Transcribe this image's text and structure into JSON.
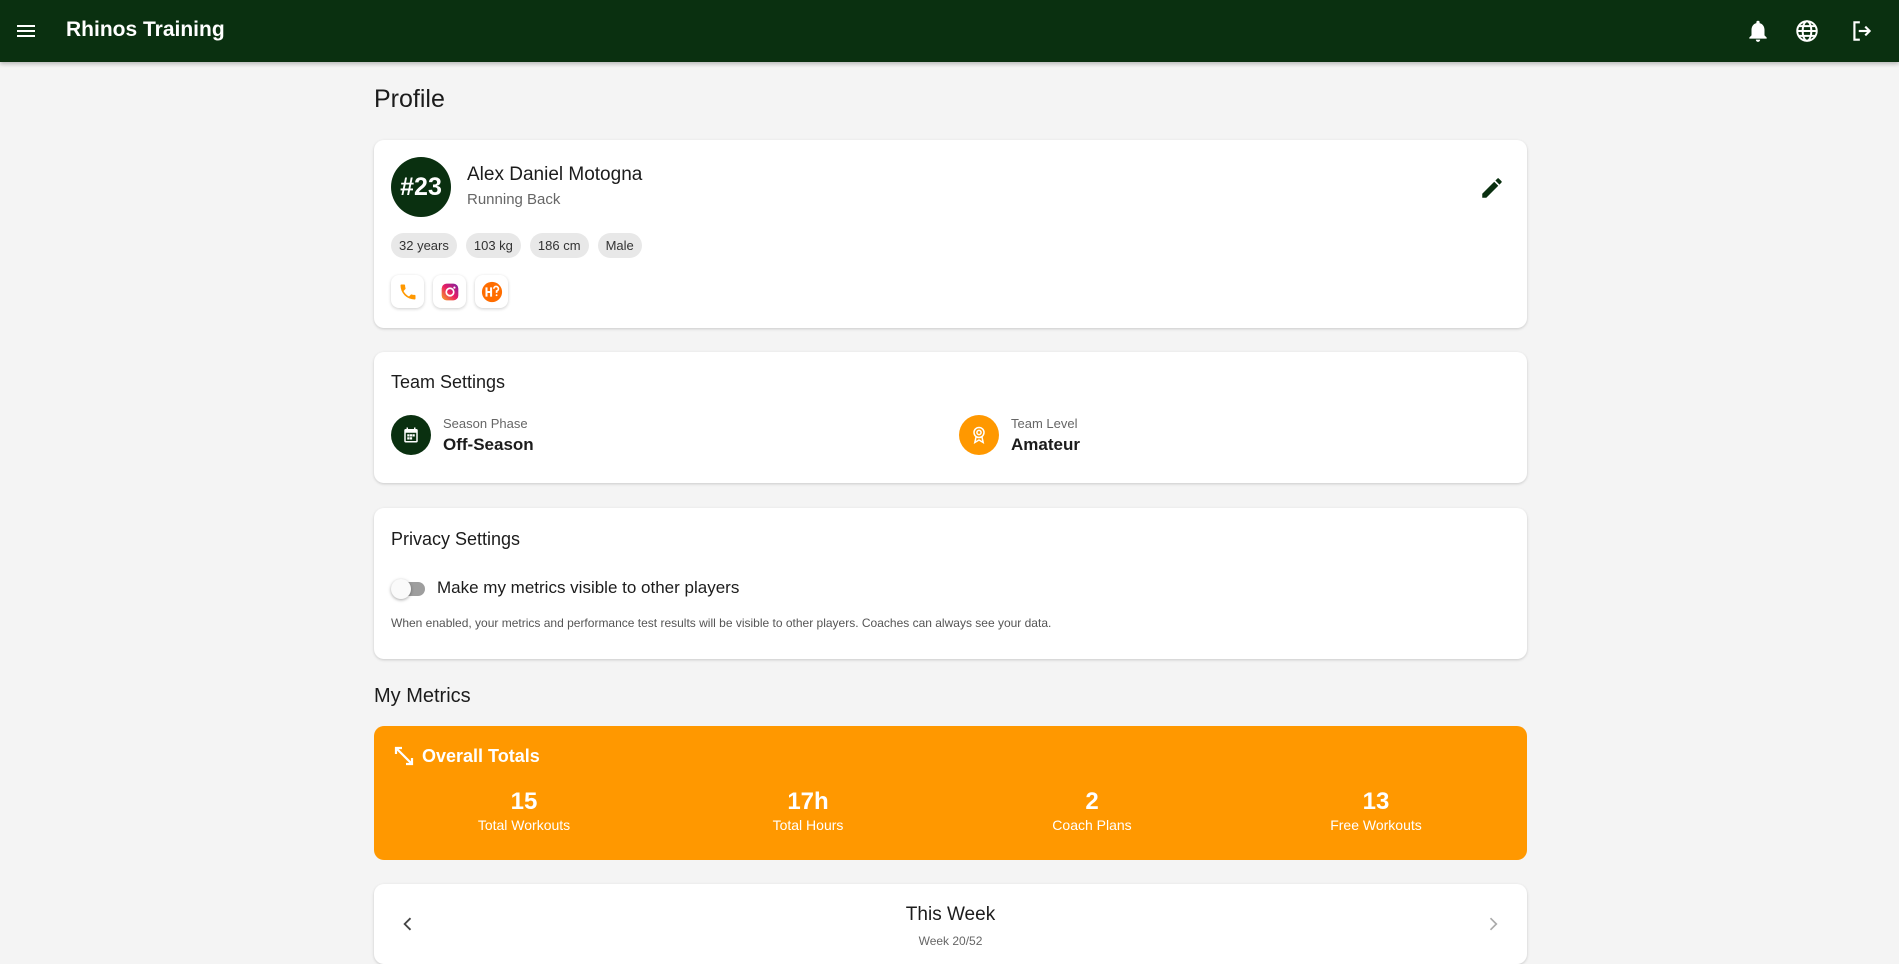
{
  "header": {
    "app_title": "Rhinos Training",
    "icons": [
      "menu-icon",
      "bell-icon",
      "globe-icon",
      "logout-icon"
    ]
  },
  "page": {
    "title": "Profile"
  },
  "profile": {
    "number": "#23",
    "name": "Alex Daniel Motogna",
    "position": "Running Back",
    "chips": [
      "32 years",
      "103 kg",
      "186 cm",
      "Male"
    ],
    "socials": [
      "phone-icon",
      "instagram-icon",
      "hudl-icon"
    ]
  },
  "team_settings": {
    "title": "Team Settings",
    "season_phase": {
      "label": "Season Phase",
      "value": "Off-Season",
      "color": "#0a3010"
    },
    "team_level": {
      "label": "Team Level",
      "value": "Amateur",
      "color": "#ff9800"
    }
  },
  "privacy": {
    "title": "Privacy Settings",
    "toggle_label": "Make my metrics visible to other players",
    "toggle_on": false,
    "note": "When enabled, your metrics and performance test results will be visible to other players. Coaches can always see your data."
  },
  "metrics": {
    "section_title": "My Metrics",
    "totals": {
      "title": "Overall Totals",
      "stats": [
        {
          "value": "15",
          "label": "Total Workouts"
        },
        {
          "value": "17h",
          "label": "Total Hours"
        },
        {
          "value": "2",
          "label": "Coach Plans"
        },
        {
          "value": "13",
          "label": "Free Workouts"
        }
      ]
    },
    "week": {
      "title": "This Week",
      "subtitle": "Week 20/52"
    }
  },
  "colors": {
    "primary": "#0a3010",
    "accent": "#ff9800",
    "background": "#f4f4f4"
  }
}
